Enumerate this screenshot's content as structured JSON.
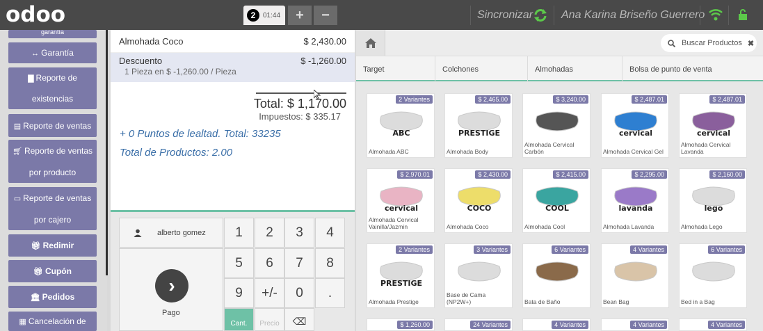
{
  "topbar": {
    "logo": "odoo",
    "order_number": "2",
    "order_time": "01:44",
    "add_label": "+",
    "remove_label": "−",
    "sync_label": "Sincronizar",
    "user_name": "Ana Karina Briseño Guerrero",
    "icons": [
      "sync-icon",
      "wifi-icon",
      "lock-icon"
    ],
    "colors": {
      "bar": "#494949",
      "sync_green": "#5cc94a"
    }
  },
  "sidebar": {
    "items": [
      {
        "label": "garantía",
        "icon": ""
      },
      {
        "label": "Garantía",
        "icon": "↔"
      },
      {
        "label": "Reporte de",
        "label2": "existencias",
        "icon": "bar-chart-icon"
      },
      {
        "label": "Reporte de ventas",
        "icon": "list-icon"
      },
      {
        "label": "Reporte de ventas",
        "label2": "por producto",
        "icon": "cart-icon"
      },
      {
        "label": "Reporte de ventas",
        "label2": "por cajero",
        "icon": "card-icon"
      },
      {
        "label": "Redimir",
        "icon": "gift-icon"
      },
      {
        "label": "Cupón",
        "icon": "gift-icon"
      },
      {
        "label": "Pedidos",
        "icon": "bank-icon"
      },
      {
        "label": "Cancelación de",
        "icon": "grid-icon"
      }
    ],
    "color": "#7b79a8"
  },
  "order": {
    "lines": [
      {
        "name": "Almohada Coco",
        "price": "$ 2,430.00"
      },
      {
        "name": "Descuento",
        "price": "$ -1,260.00",
        "info_qty": "1",
        "info_text": "Pieza en $ -1,260.00 / Pieza"
      }
    ],
    "total": "Total: $ 1,170.00",
    "taxes": "Impuestos: $ 335.17",
    "loyalty": "+ 0 Puntos de lealtad. Total: 33235",
    "products_total": "Total de Productos: 2.00"
  },
  "pad": {
    "customer": "alberto gomez",
    "pay_label": "Pago",
    "keys": [
      "1",
      "2",
      "3",
      "4",
      "5",
      "6",
      "7",
      "8",
      "9",
      "+/-",
      "0",
      "."
    ],
    "mode_qty": "Cant.",
    "mode_price": "Precio",
    "backspace": "⌫"
  },
  "products": {
    "search_placeholder": "Buscar Productos",
    "categories": [
      "Target",
      "Colchones",
      "Almohadas",
      "Bolsa de punto de venta"
    ],
    "rows": [
      [
        {
          "name": "Almohada ABC",
          "badge": "2 Variantes",
          "brand": "ABC"
        },
        {
          "name": "Almohada Body",
          "badge": "$ 2,465.00",
          "brand": "PRESTIGE"
        },
        {
          "name": "Almohada Cervical Carbón",
          "badge": "$ 3,240.00",
          "brand": ""
        },
        {
          "name": "Almohada Cervical Gel",
          "badge": "$ 2,487.01",
          "brand": "cervical"
        },
        {
          "name": "Almohada Cervical Lavanda",
          "badge": "$ 2,487.01",
          "brand": "cervical"
        }
      ],
      [
        {
          "name": "Almohada Cervical Vainilla/Jazmin",
          "badge": "$ 2,970.01",
          "brand": "cervical"
        },
        {
          "name": "Almohada Coco",
          "badge": "$ 2,430.00",
          "brand": "COCO"
        },
        {
          "name": "Almohada Cool",
          "badge": "$ 2,415.00",
          "brand": "COOL"
        },
        {
          "name": "Almohada Lavanda",
          "badge": "$ 2,295.00",
          "brand": "lavanda"
        },
        {
          "name": "Almohada Lego",
          "badge": "$ 2,160.00",
          "brand": "lego"
        }
      ],
      [
        {
          "name": "Almohada Prestige",
          "badge": "2 Variantes",
          "brand": "PRESTIGE"
        },
        {
          "name": "Base de Cama (NP2W+)",
          "badge": "3 Variantes",
          "brand": ""
        },
        {
          "name": "Bata de Baño",
          "badge": "6 Variantes",
          "brand": ""
        },
        {
          "name": "Bean Bag",
          "badge": "4 Variantes",
          "brand": ""
        },
        {
          "name": "Bed in a Bag",
          "badge": "6 Variantes",
          "brand": ""
        }
      ],
      [
        {
          "name": "",
          "badge": "$ 1,260.00",
          "brand": ""
        },
        {
          "name": "",
          "badge": "24 Variantes",
          "brand": ""
        },
        {
          "name": "",
          "badge": "4 Variantes",
          "brand": ""
        },
        {
          "name": "",
          "badge": "4 Variantes",
          "brand": ""
        },
        {
          "name": "",
          "badge": "4 Variantes",
          "brand": ""
        }
      ]
    ],
    "colors": {
      "badge": "#7b79a8",
      "accent": "#6ec1a6"
    }
  }
}
